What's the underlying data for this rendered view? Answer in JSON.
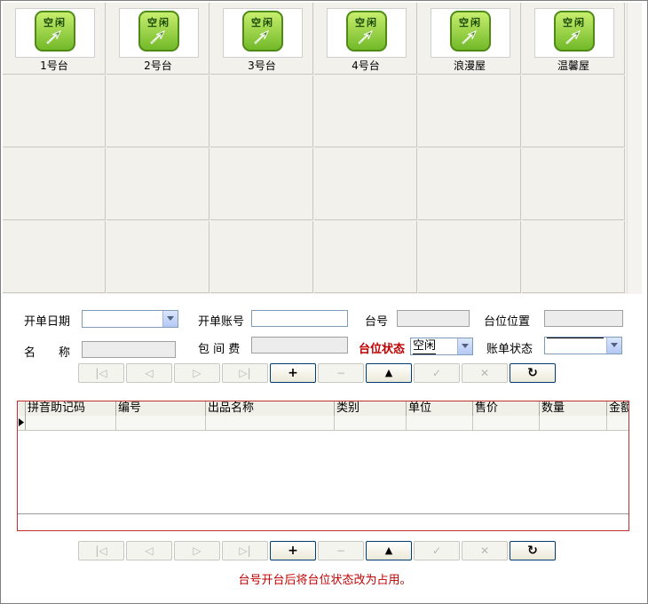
{
  "tables": [
    {
      "status": "空闲",
      "name": "1号台"
    },
    {
      "status": "空闲",
      "name": "2号台"
    },
    {
      "status": "空闲",
      "name": "3号台"
    },
    {
      "status": "空闲",
      "name": "4号台"
    },
    {
      "status": "空闲",
      "name": "浪漫屋"
    },
    {
      "status": "空闲",
      "name": "温馨屋"
    }
  ],
  "form": {
    "open_date_label": "开单日期",
    "open_date_value": "",
    "account_label": "开单账号",
    "account_value": "",
    "table_no_label": "台号",
    "table_no_value": "",
    "position_label": "台位位置",
    "position_value": "",
    "name_label": "名　　称",
    "name_value": "",
    "room_fee_label": "包 间 费",
    "room_fee_value": "",
    "table_status_label": "台位状态",
    "table_status_value": "空闲",
    "bill_status_label": "账单状态",
    "bill_status_value": ""
  },
  "nav_buttons": [
    {
      "name": "first",
      "glyph": "|◁",
      "enabled": false
    },
    {
      "name": "prev",
      "glyph": "◁",
      "enabled": false
    },
    {
      "name": "next",
      "glyph": "▷",
      "enabled": false
    },
    {
      "name": "last",
      "glyph": "▷|",
      "enabled": false
    },
    {
      "name": "add",
      "glyph": "+",
      "enabled": true
    },
    {
      "name": "delete",
      "glyph": "−",
      "enabled": false
    },
    {
      "name": "edit",
      "glyph": "▲",
      "enabled": true
    },
    {
      "name": "post",
      "glyph": "✓",
      "enabled": false
    },
    {
      "name": "cancel",
      "glyph": "✕",
      "enabled": false
    },
    {
      "name": "refresh",
      "glyph": "↻",
      "enabled": true
    }
  ],
  "columns": [
    "拼音助记码",
    "编号",
    "出品名称",
    "类别",
    "单位",
    "售价",
    "数量",
    "金额"
  ],
  "tip": "台号开台后将台位状态改为占用。",
  "colors": {
    "accent_red": "#c00000",
    "icon_green": "#72b928"
  }
}
